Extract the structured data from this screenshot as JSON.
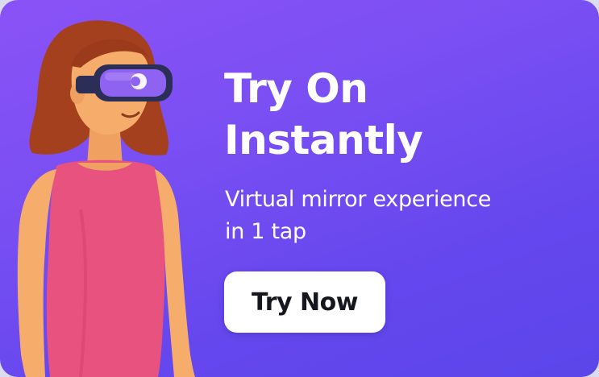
{
  "banner": {
    "headline_line1": "Try On",
    "headline_line2": "Instantly",
    "subhead_line1": "Virtual mirror experience",
    "subhead_line2": "in 1 tap",
    "cta_label": "Try Now"
  },
  "illustration": {
    "description_icon": "woman-vr-headset-illustration"
  },
  "colors": {
    "background_start": "#8a52f6",
    "background_end": "#5b46ea",
    "button_background": "#ffffff",
    "button_text": "#16161e",
    "text": "#ffffff",
    "hair": "#a5401f",
    "dress": "#e8527f",
    "skin": "#f6ad6b",
    "headset_lens": "#8f63f2"
  }
}
